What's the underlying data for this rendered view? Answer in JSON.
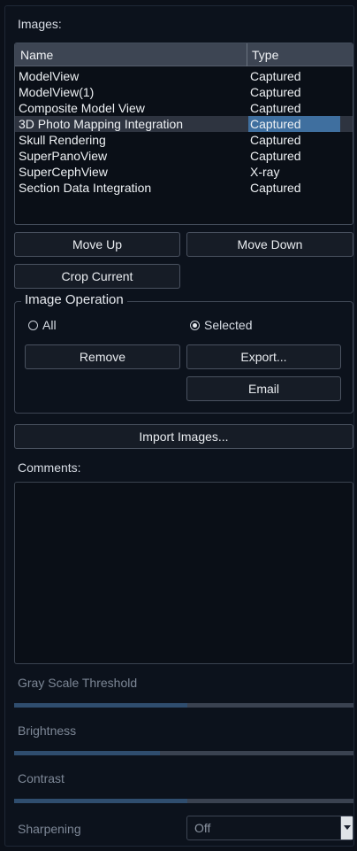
{
  "images": {
    "label": "Images:",
    "columns": {
      "name": "Name",
      "type": "Type"
    },
    "rows": [
      {
        "name": "ModelView",
        "type": "Captured"
      },
      {
        "name": "ModelView(1)",
        "type": "Captured"
      },
      {
        "name": "Composite Model View",
        "type": "Captured"
      },
      {
        "name": "3D Photo Mapping Integration",
        "type": "Captured",
        "selected": true
      },
      {
        "name": "Skull Rendering",
        "type": "Captured"
      },
      {
        "name": "SuperPanoView",
        "type": "Captured"
      },
      {
        "name": "SuperCephView",
        "type": "X-ray"
      },
      {
        "name": "Section Data Integration",
        "type": "Captured"
      }
    ]
  },
  "buttons": {
    "move_up": "Move Up",
    "move_down": "Move Down",
    "crop_current": "Crop Current",
    "import_images": "Import Images..."
  },
  "image_operation": {
    "title": "Image Operation",
    "radio_all": "All",
    "radio_selected": "Selected",
    "selected_option": "Selected",
    "remove": "Remove",
    "export": "Export...",
    "email": "Email"
  },
  "comments": {
    "label": "Comments:",
    "value": ""
  },
  "sliders": {
    "gray_scale_threshold": {
      "label": "Gray Scale Threshold",
      "level": 0.51
    },
    "brightness": {
      "label": "Brightness",
      "level": 0.43
    },
    "contrast": {
      "label": "Contrast",
      "level": 0.51
    }
  },
  "sharpening": {
    "label": "Sharpening",
    "value": "Off"
  },
  "colors": {
    "background": "#0b1019",
    "selection_highlight": "#3f6f9f",
    "slider_fill": "#2f4d6e"
  },
  "icons": {
    "radio_unchecked": "radio-unchecked-icon",
    "radio_checked": "radio-checked-icon",
    "dropdown": "chevron-down-icon"
  }
}
